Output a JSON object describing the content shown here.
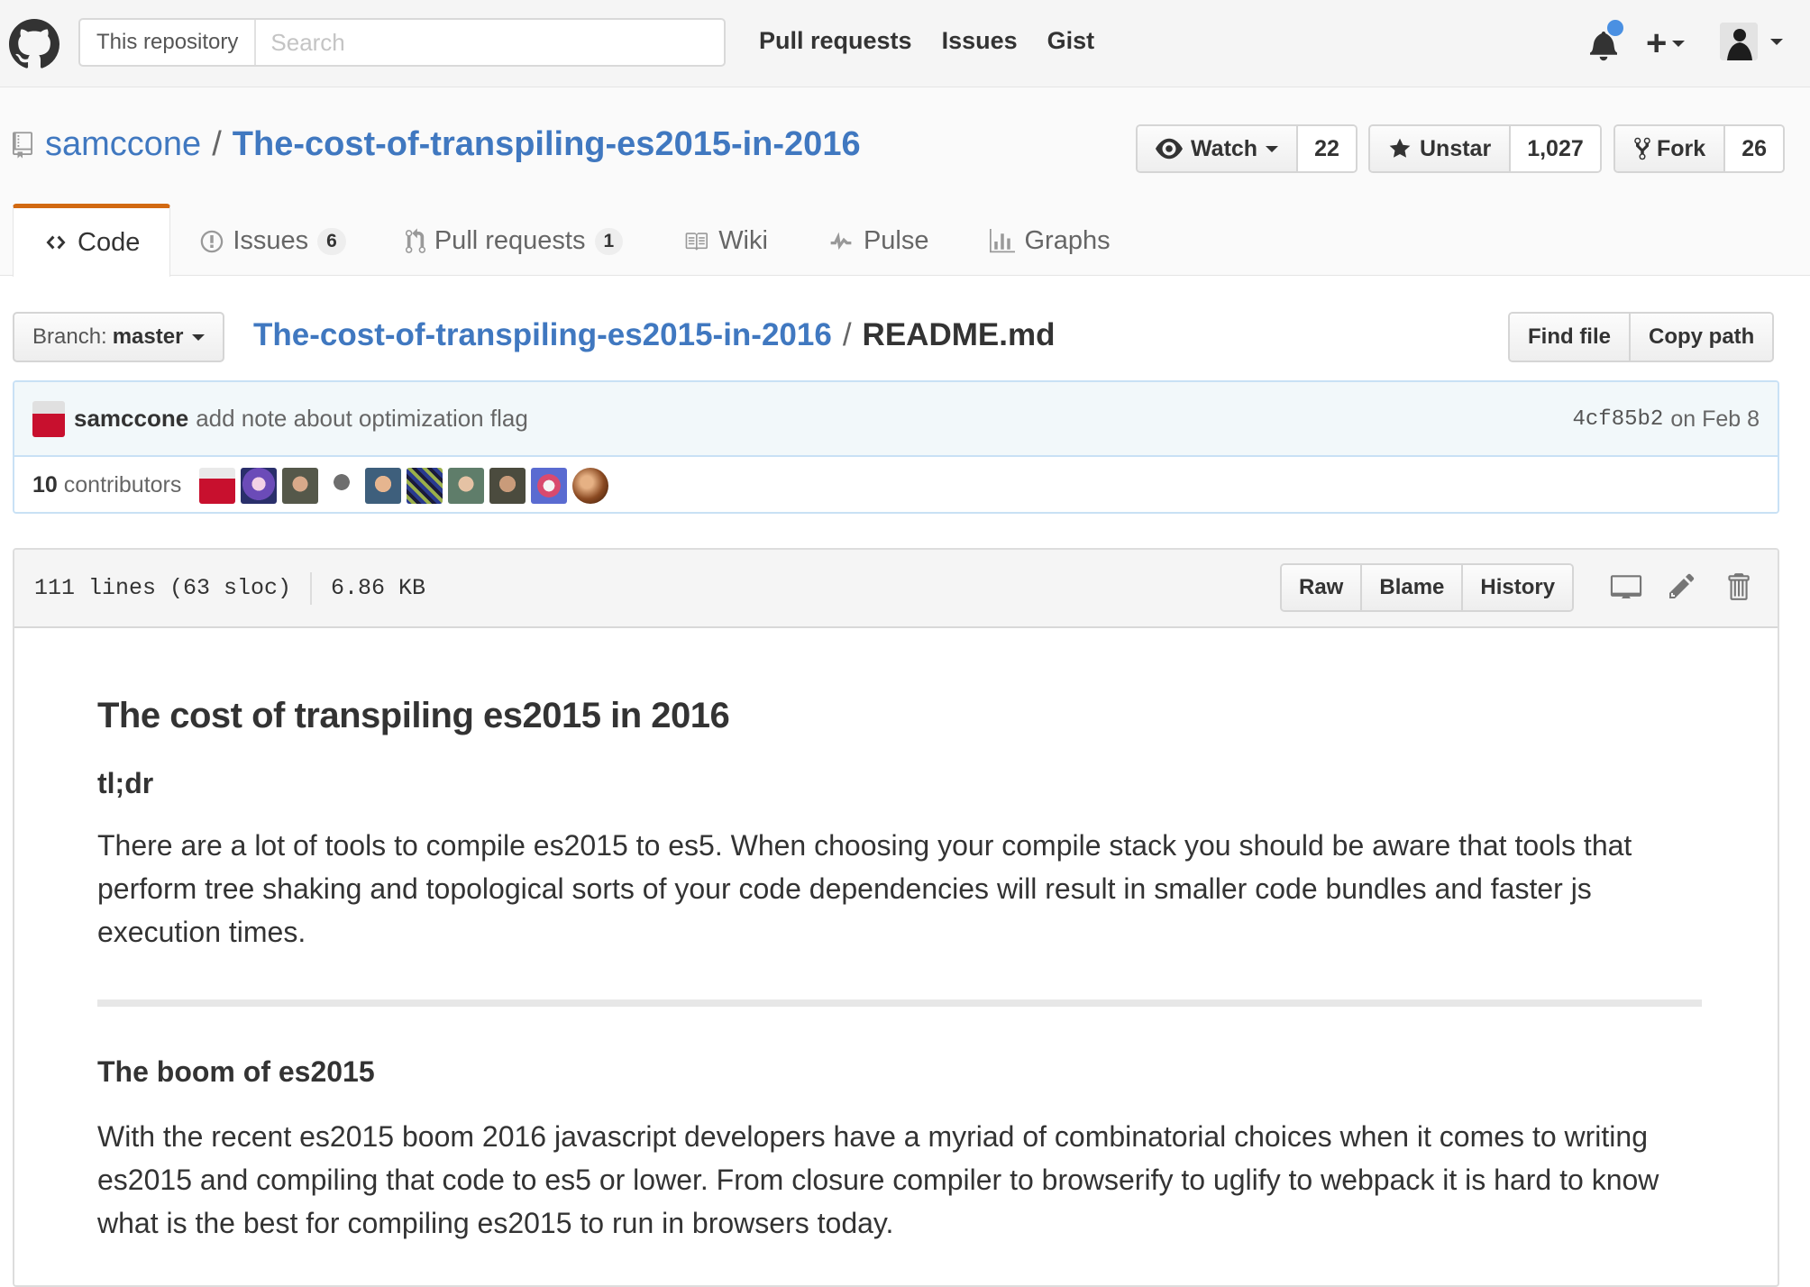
{
  "header": {
    "search_scope": "This repository",
    "search_placeholder": "Search",
    "nav": [
      "Pull requests",
      "Issues",
      "Gist"
    ],
    "notification_dot_color": "#4a90e2"
  },
  "repo": {
    "owner": "samccone",
    "separator": "/",
    "name": "The-cost-of-transpiling-es2015-in-2016",
    "watch": {
      "label": "Watch",
      "count": "22"
    },
    "star": {
      "label": "Unstar",
      "count": "1,027"
    },
    "fork": {
      "label": "Fork",
      "count": "26"
    }
  },
  "tabs": [
    {
      "label": "Code",
      "counter": null,
      "icon": "code-icon"
    },
    {
      "label": "Issues",
      "counter": "6",
      "icon": "issue-opened-icon"
    },
    {
      "label": "Pull requests",
      "counter": "1",
      "icon": "git-pull-request-icon"
    },
    {
      "label": "Wiki",
      "counter": null,
      "icon": "book-icon"
    },
    {
      "label": "Pulse",
      "counter": null,
      "icon": "pulse-icon"
    },
    {
      "label": "Graphs",
      "counter": null,
      "icon": "graph-icon"
    }
  ],
  "file_nav": {
    "branch_prefix": "Branch:",
    "branch": "master",
    "repo_link": "The-cost-of-transpiling-es2015-in-2016",
    "separator": "/",
    "file_name": "README.md",
    "find_file": "Find file",
    "copy_path": "Copy path"
  },
  "commit": {
    "author": "samccone",
    "message": "add note about optimization flag",
    "sha": "4cf85b2",
    "date": "on Feb 8",
    "contributors_count": "10",
    "contributors_label": "contributors"
  },
  "file_header": {
    "lines": "111 lines (63 sloc)",
    "size": "6.86 KB",
    "raw": "Raw",
    "blame": "Blame",
    "history": "History"
  },
  "readme": {
    "title": "The cost of transpiling es2015 in 2016",
    "tldr_heading": "tl;dr",
    "tldr_body": "There are a lot of tools to compile es2015 to es5. When choosing your compile stack you should be aware that tools that perform tree shaking and topological sorts of your code dependencies will result in smaller code bundles and faster js execution times.",
    "boom_heading": "The boom of es2015",
    "boom_body": "With the recent es2015 boom 2016 javascript developers have a myriad of combinatorial choices when it comes to writing es2015 and compiling that code to es5 or lower. From closure compiler to browserify to uglify to webpack it is hard to know what is the best for compiling es2015 to run in browsers today."
  },
  "colors": {
    "link": "#4078c0",
    "selected_tab_border": "#d26911",
    "commit_bg": "#f2f8fa",
    "commit_border": "#c9e1f5"
  }
}
